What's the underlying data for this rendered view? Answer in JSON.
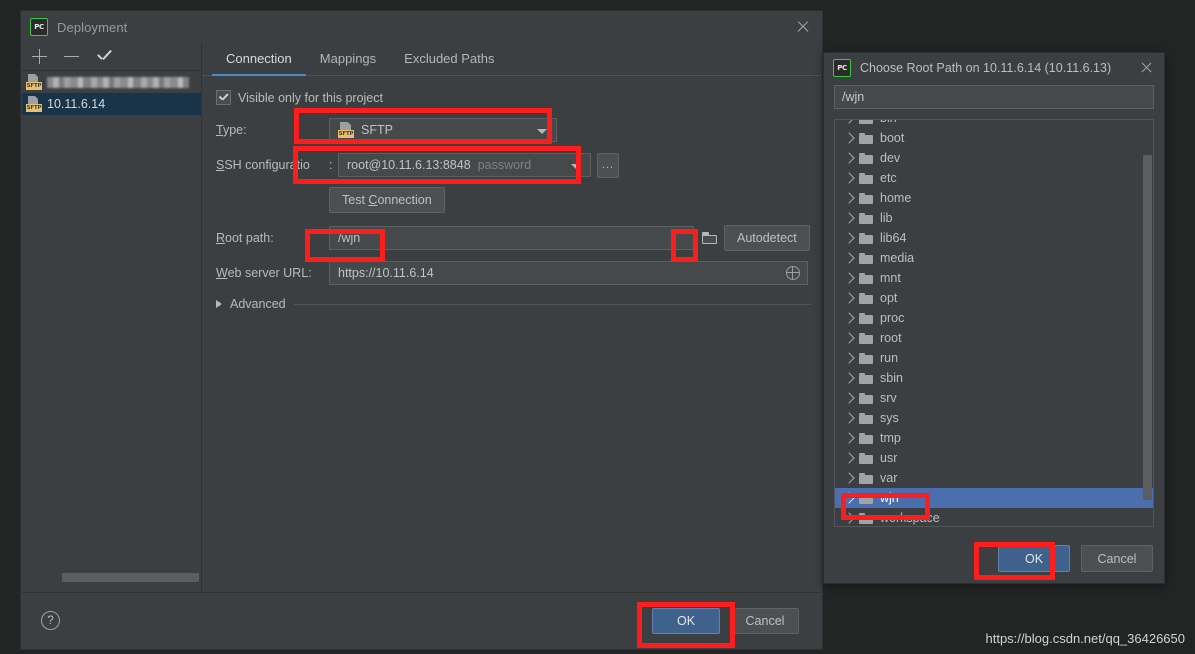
{
  "deployment_dialog": {
    "title": "Deployment",
    "logo_text": "PC",
    "close_icon": "close-icon",
    "sidebar": {
      "toolbar": {
        "add": "+",
        "remove": "−",
        "set_default": "✓"
      },
      "servers": [
        {
          "name": "",
          "blurred": true,
          "type_tag": "SFTP"
        },
        {
          "name": "10.11.6.14",
          "blurred": false,
          "type_tag": "SFTP",
          "selected": true
        }
      ]
    },
    "tabs": [
      {
        "label": "Connection",
        "active": true
      },
      {
        "label": "Mappings",
        "active": false
      },
      {
        "label": "Excluded Paths",
        "active": false
      }
    ],
    "form": {
      "visible_only_checkbox": {
        "label": "Visible only for this project",
        "checked": true
      },
      "type": {
        "label": "Type:",
        "value": "SFTP",
        "icon": "sftp-icon"
      },
      "ssh_configuration": {
        "label": "SSH configuratio",
        "label_suffix": ":",
        "value": "root@10.11.6.13:8848",
        "auth": "password",
        "browse_button": "..."
      },
      "test_connection_button": "Test Connection",
      "root_path": {
        "label": "Root path:",
        "value": "/wjn",
        "folder_icon": "folder-icon",
        "autodetect_button": "Autodetect"
      },
      "web_server_url": {
        "label": "Web server URL:",
        "value": "https://10.11.6.14",
        "globe_icon": "globe-icon"
      },
      "advanced": {
        "label": "Advanced",
        "expanded": false
      }
    },
    "footer": {
      "help": "?",
      "ok": "OK",
      "cancel": "Cancel"
    }
  },
  "root_path_dialog": {
    "title": "Choose Root Path on 10.11.6.14 (10.11.6.13)",
    "logo_text": "PC",
    "close_icon": "close-icon",
    "path_input": {
      "value": "/wjn",
      "placeholder": ""
    },
    "tree": [
      {
        "label": "bin",
        "selected": false
      },
      {
        "label": "boot",
        "selected": false
      },
      {
        "label": "dev",
        "selected": false
      },
      {
        "label": "etc",
        "selected": false
      },
      {
        "label": "home",
        "selected": false
      },
      {
        "label": "lib",
        "selected": false
      },
      {
        "label": "lib64",
        "selected": false
      },
      {
        "label": "media",
        "selected": false
      },
      {
        "label": "mnt",
        "selected": false
      },
      {
        "label": "opt",
        "selected": false
      },
      {
        "label": "proc",
        "selected": false
      },
      {
        "label": "root",
        "selected": false
      },
      {
        "label": "run",
        "selected": false
      },
      {
        "label": "sbin",
        "selected": false
      },
      {
        "label": "srv",
        "selected": false
      },
      {
        "label": "sys",
        "selected": false
      },
      {
        "label": "tmp",
        "selected": false
      },
      {
        "label": "usr",
        "selected": false
      },
      {
        "label": "var",
        "selected": false
      },
      {
        "label": "wjn",
        "selected": true
      },
      {
        "label": "workspace",
        "selected": false
      }
    ],
    "footer": {
      "ok": "OK",
      "cancel": "Cancel"
    }
  },
  "annotations": {
    "highlight_color": "#fc1d1d",
    "boxes": [
      {
        "name": "type-combo-highlight"
      },
      {
        "name": "ssh-configuration-highlight"
      },
      {
        "name": "root-path-field-highlight"
      },
      {
        "name": "root-path-browse-highlight"
      },
      {
        "name": "tree-wjn-highlight"
      },
      {
        "name": "rootpath-ok-highlight"
      },
      {
        "name": "deployment-ok-highlight"
      }
    ]
  },
  "watermark": {
    "text": "https://blog.csdn.net/qq_36426650"
  }
}
